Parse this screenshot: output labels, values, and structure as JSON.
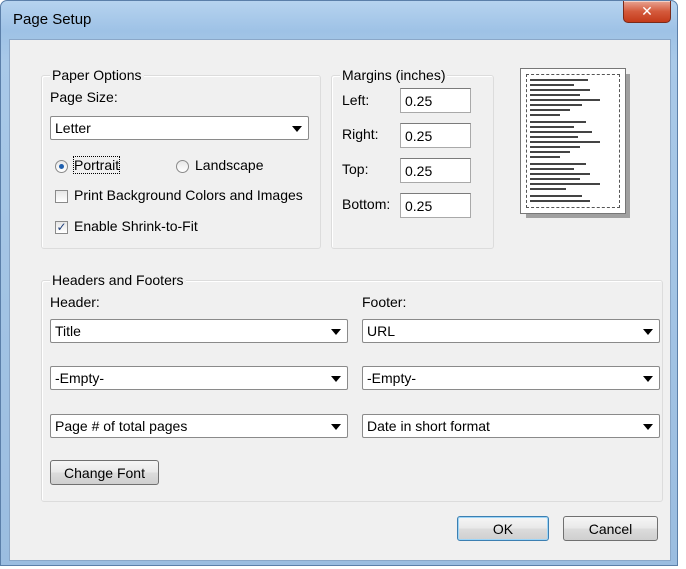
{
  "window": {
    "title": "Page Setup",
    "close_glyph": "✕"
  },
  "paper_options": {
    "legend": "Paper Options",
    "page_size_label": "Page Size:",
    "page_size_value": "Letter",
    "portrait_label": "Portrait",
    "landscape_label": "Landscape",
    "print_bg_label": "Print Background Colors and Images",
    "shrink_label": "Enable Shrink-to-Fit",
    "orientation": "portrait",
    "print_bg_checked": false,
    "shrink_checked": true
  },
  "margins": {
    "legend": "Margins (inches)",
    "left_label": "Left:",
    "left_value": "0.25",
    "right_label": "Right:",
    "right_value": "0.25",
    "top_label": "Top:",
    "top_value": "0.25",
    "bottom_label": "Bottom:",
    "bottom_value": "0.25"
  },
  "headers_footers": {
    "legend": "Headers and Footers",
    "header_label": "Header:",
    "footer_label": "Footer:",
    "header_values": [
      "Title",
      "-Empty-",
      "Page # of total pages"
    ],
    "footer_values": [
      "URL",
      "-Empty-",
      "Date in short format"
    ],
    "change_font_label": "Change Font"
  },
  "buttons": {
    "ok_label": "OK",
    "cancel_label": "Cancel"
  },
  "icons": {
    "dropdown": "chevron-down-icon",
    "close": "close-icon",
    "check": "checkmark-icon"
  }
}
